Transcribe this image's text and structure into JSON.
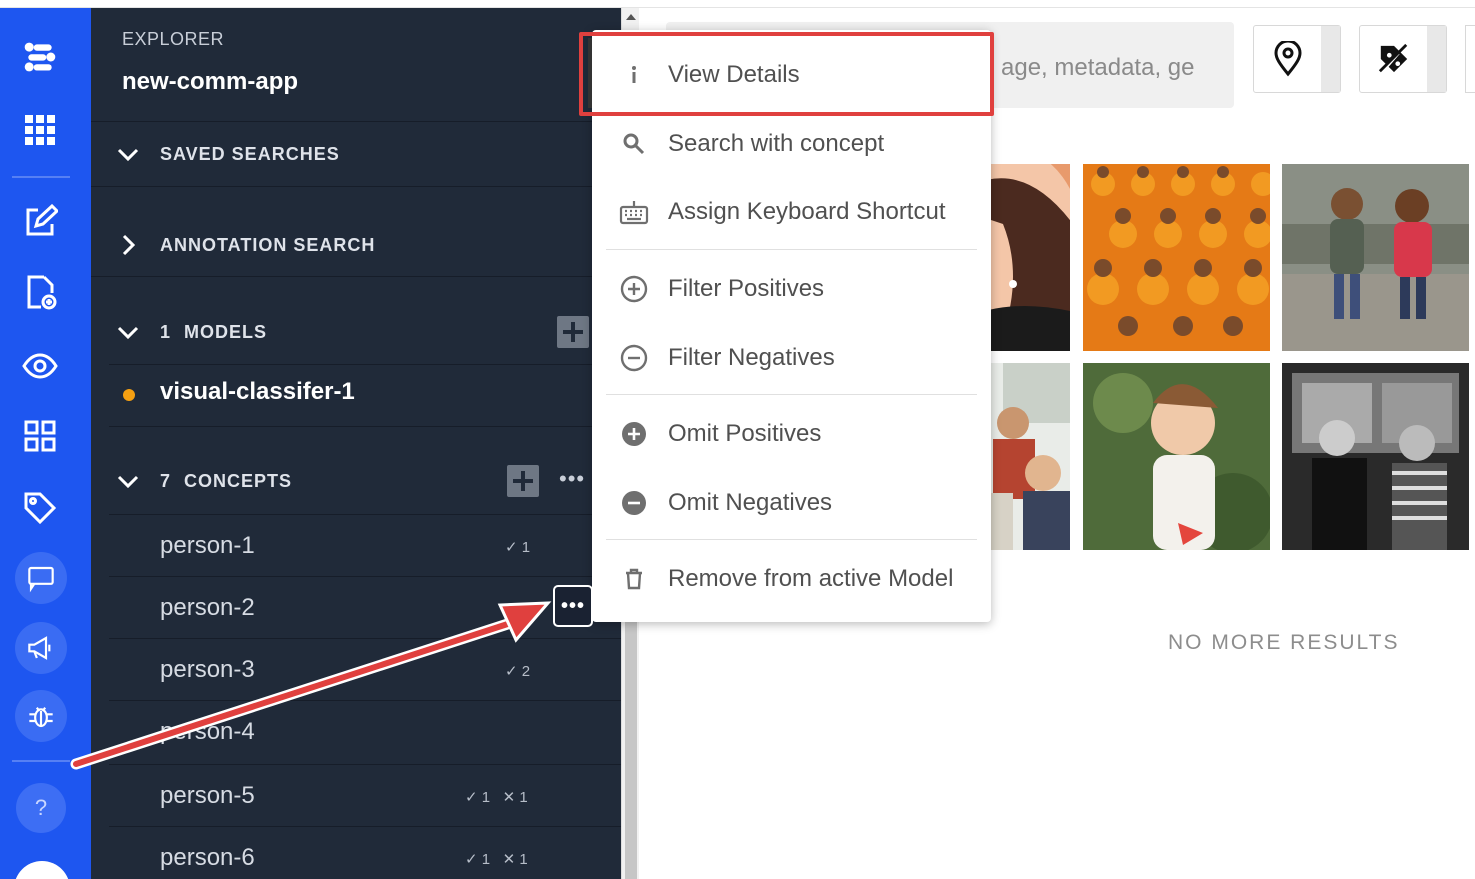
{
  "sidebar": {
    "section_label": "EXPLORER",
    "app_name": "new-comm-app",
    "saved_searches": "SAVED SEARCHES",
    "annotation_search": "ANNOTATION SEARCH",
    "models_count": "1",
    "models_label": "MODELS",
    "model_name": "visual-classifer-1",
    "concepts_count": "7",
    "concepts_label": "CONCEPTS",
    "concepts": [
      {
        "name": "person-1",
        "stat": "✓ 1"
      },
      {
        "name": "person-2",
        "stat": ""
      },
      {
        "name": "person-3",
        "stat": "✓ 2"
      },
      {
        "name": "person-4",
        "stat": ""
      },
      {
        "name": "person-5",
        "stat": "✓ 1   ✕ 1"
      },
      {
        "name": "person-6",
        "stat": "✓ 1   ✕ 1"
      }
    ],
    "more_dots": "•••"
  },
  "search": {
    "placeholder_visible": "age, metadata, ge"
  },
  "main": {
    "no_more_results": "NO MORE RESULTS"
  },
  "menu": {
    "items": [
      {
        "label": "View Details",
        "icon": "info-icon"
      },
      {
        "label": "Search with concept",
        "icon": "search-icon"
      },
      {
        "label": "Assign Keyboard Shortcut",
        "icon": "keyboard-icon"
      },
      {
        "label": "Filter Positives",
        "icon": "plus-circle-outline-icon"
      },
      {
        "label": "Filter Negatives",
        "icon": "minus-circle-outline-icon"
      },
      {
        "label": "Omit Positives",
        "icon": "plus-circle-icon"
      },
      {
        "label": "Omit Negatives",
        "icon": "minus-circle-icon"
      },
      {
        "label": "Remove from active Model",
        "icon": "trash-icon"
      }
    ]
  },
  "rail": {
    "help": "?"
  },
  "colors": {
    "rail": "#1e56f0",
    "sidebar": "#202a39",
    "accent_dot": "#f5a012",
    "highlight": "#e0403e"
  }
}
